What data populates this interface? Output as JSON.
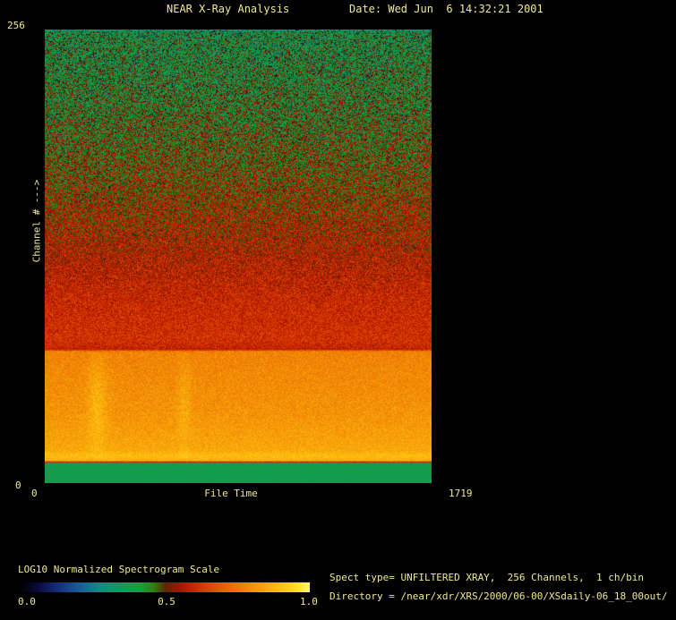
{
  "header": {
    "title": "NEAR X-Ray Analysis",
    "date": "Date: Wed Jun  6 14:32:21 2001"
  },
  "plot": {
    "y_axis": {
      "max_label": "256",
      "min_label": "0",
      "title": "Channel # --->"
    },
    "x_axis": {
      "min_label": "0",
      "title": "File Time",
      "max_label": "1719"
    }
  },
  "colorbar": {
    "label": "LOG10 Normalized Spectrogram Scale",
    "ticks": [
      "0.0",
      "0.5",
      "1.0"
    ]
  },
  "info": {
    "spect_type": "Spect type= UNFILTERED XRAY,  256 Channels,  1 ch/bin",
    "directory": "Directory = /near/xdr/XRS/2000/06-00/XSdaily-06_18_00out/"
  },
  "colors": {
    "background": "#000000",
    "text": "#f0ea90",
    "bottom_strip_green": "#0f9560"
  },
  "chart_data": {
    "type": "heatmap",
    "title": "NEAR X-Ray Analysis",
    "xlabel": "File Time",
    "ylabel": "Channel # --->",
    "x_range": [
      0,
      1719
    ],
    "y_range": [
      0,
      256
    ],
    "scale_label": "LOG10 Normalized Spectrogram Scale",
    "scale_range": [
      0.0,
      1.0
    ],
    "legend_position": "bottom-left",
    "grid": false,
    "bands": [
      {
        "channels": [
          256,
          130
        ],
        "description": "noisy green (normalized ~0.40-0.50) with scattered dark/black and red specks, value rising toward lower channels"
      },
      {
        "channels": [
          130,
          75
        ],
        "description": "noisy red/orange-red (~0.55-0.62), occasional green specks"
      },
      {
        "channels": [
          75,
          12
        ],
        "description": "bright orange/amber band (~0.77-0.85) with faint brighter vertical streaks near x~0.13 and x~0.36 of width; brightest yellow row (~0.89) at band bottom"
      },
      {
        "channels": [
          12,
          0
        ],
        "description": "flat solid sea-green strip (~0.37), no noise"
      }
    ],
    "colormap": [
      [
        0.0,
        "#000005"
      ],
      [
        0.06,
        "#0b0b3e"
      ],
      [
        0.13,
        "#143080"
      ],
      [
        0.2,
        "#1a5a96"
      ],
      [
        0.27,
        "#128c84"
      ],
      [
        0.34,
        "#0f9a5c"
      ],
      [
        0.41,
        "#16a038"
      ],
      [
        0.46,
        "#2e7e10"
      ],
      [
        0.5,
        "#5c2600"
      ],
      [
        0.55,
        "#a61400"
      ],
      [
        0.61,
        "#d22c00"
      ],
      [
        0.69,
        "#e65a06"
      ],
      [
        0.78,
        "#f28806"
      ],
      [
        0.88,
        "#fcb80e"
      ],
      [
        0.95,
        "#ffdc1e"
      ],
      [
        1.0,
        "#fff964"
      ]
    ],
    "value_profile": [
      {
        "f": 0.0,
        "v": 0.3,
        "n": 0.08
      },
      {
        "f": 0.004,
        "v": 0.4,
        "n": 0.13
      },
      {
        "f": 0.15,
        "v": 0.44,
        "n": 0.13
      },
      {
        "f": 0.3,
        "v": 0.49,
        "n": 0.12
      },
      {
        "f": 0.45,
        "v": 0.55,
        "n": 0.1
      },
      {
        "f": 0.6,
        "v": 0.6,
        "n": 0.07
      },
      {
        "f": 0.688,
        "v": 0.615,
        "n": 0.06
      },
      {
        "f": 0.706,
        "v": 0.585,
        "n": 0.05
      },
      {
        "f": 0.71,
        "v": 0.77,
        "n": 0.05
      },
      {
        "f": 0.85,
        "v": 0.805,
        "n": 0.05
      },
      {
        "f": 0.928,
        "v": 0.845,
        "n": 0.04
      },
      {
        "f": 0.94,
        "v": 0.89,
        "n": 0.035
      },
      {
        "f": 0.951,
        "v": 0.87,
        "n": 0.03
      },
      {
        "f": 0.9545,
        "v": 0.6,
        "n": 0.04
      },
      {
        "f": 0.9565,
        "v": 0.37,
        "n": 0.008
      },
      {
        "f": 1.0,
        "v": 0.37,
        "n": 0.008
      }
    ],
    "specks": {
      "max_prob": 0.1,
      "fade_end": 0.55,
      "value_max": 0.15
    },
    "streaks": [
      {
        "x": 0.135,
        "w": 0.018,
        "boost": 0.07,
        "band": [
          0.712,
          0.948
        ],
        "center": 0.82,
        "spread": 0.075
      },
      {
        "x": 0.36,
        "w": 0.012,
        "boost": 0.05,
        "band": [
          0.712,
          0.948
        ],
        "center": 0.82,
        "spread": 0.075
      }
    ]
  }
}
